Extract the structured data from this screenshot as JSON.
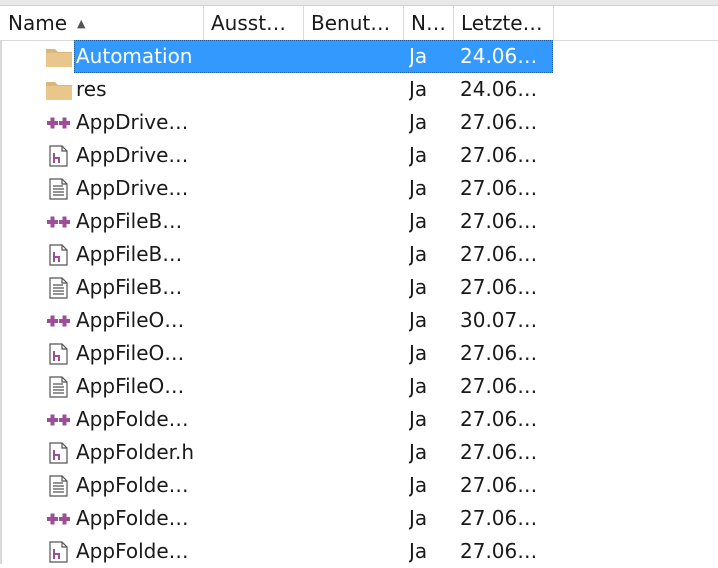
{
  "columns": {
    "name": "Name",
    "ausst": "Ausst…",
    "benut": "Benut…",
    "n": "N…",
    "letzte": "Letzte…"
  },
  "rows": [
    {
      "name": "Automation",
      "icon": "folder-icon",
      "n": "Ja",
      "date": "24.06…",
      "selected": true
    },
    {
      "name": "res",
      "icon": "folder-icon",
      "n": "Ja",
      "date": "24.06…"
    },
    {
      "name": "AppDrive…",
      "icon": "cpp-source-icon",
      "n": "Ja",
      "date": "27.06…"
    },
    {
      "name": "AppDrive…",
      "icon": "header-file-icon",
      "n": "Ja",
      "date": "27.06…"
    },
    {
      "name": "AppDrive…",
      "icon": "text-file-icon",
      "n": "Ja",
      "date": "27.06…"
    },
    {
      "name": "AppFileB…",
      "icon": "cpp-source-icon",
      "n": "Ja",
      "date": "27.06…"
    },
    {
      "name": "AppFileB…",
      "icon": "header-file-icon",
      "n": "Ja",
      "date": "27.06…"
    },
    {
      "name": "AppFileB…",
      "icon": "text-file-icon",
      "n": "Ja",
      "date": "27.06…"
    },
    {
      "name": "AppFileO…",
      "icon": "cpp-source-icon",
      "n": "Ja",
      "date": "30.07…"
    },
    {
      "name": "AppFileO…",
      "icon": "header-file-icon",
      "n": "Ja",
      "date": "27.06…"
    },
    {
      "name": "AppFileO…",
      "icon": "text-file-icon",
      "n": "Ja",
      "date": "27.06…"
    },
    {
      "name": "AppFolde…",
      "icon": "cpp-source-icon",
      "n": "Ja",
      "date": "27.06…"
    },
    {
      "name": "AppFolder.h",
      "icon": "header-file-icon",
      "n": "Ja",
      "date": "27.06…"
    },
    {
      "name": "AppFolde…",
      "icon": "text-file-icon",
      "n": "Ja",
      "date": "27.06…"
    },
    {
      "name": "AppFolde…",
      "icon": "cpp-source-icon",
      "n": "Ja",
      "date": "27.06…"
    },
    {
      "name": "AppFolde…",
      "icon": "header-file-icon",
      "n": "Ja",
      "date": "27.06…"
    }
  ],
  "colors": {
    "selection": "#3399ff",
    "folder": "#dcb67a",
    "cpp": "#9b4f96",
    "header": "#9b4f96"
  }
}
